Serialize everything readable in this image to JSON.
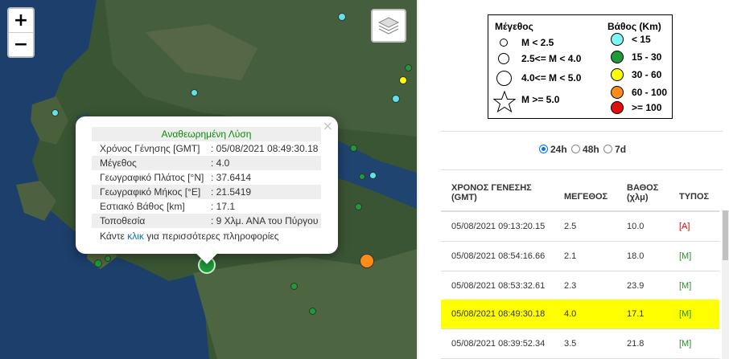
{
  "map": {
    "zoom_in_label": "+",
    "zoom_out_label": "−",
    "layers_icon": "layers-icon",
    "popup": {
      "title": "Αναθεωρημένη Λύση",
      "close_label": "×",
      "rows": [
        {
          "label": "Χρόνος Γένησης [GMT]",
          "value": ": 05/08/2021 08:49:30.18"
        },
        {
          "label": "Μέγεθος",
          "value": ": 4.0"
        },
        {
          "label": "Γεωγραφικό Πλάτος [°N]",
          "value": ": 37.6414"
        },
        {
          "label": "Γεωγραφικό Μήκος [°E]",
          "value": ": 21.5419"
        },
        {
          "label": "Εστιακό Βάθος [km]",
          "value": ": 17.1"
        },
        {
          "label": "Τοποθεσία",
          "value": ": 9 Χλμ. ΑΝΑ του Πύργου"
        }
      ],
      "footer_prefix": "Κάντε",
      "footer_link": "κλικ",
      "footer_suffix": "για περισσότερες πληροφορίες"
    }
  },
  "legend": {
    "magnitude_title": "Μέγεθος",
    "depth_title": "Βάθος (Km)",
    "magnitude_items": [
      "M < 2.5",
      "2.5<= M < 4.0",
      "4.0<= M < 5.0",
      "M >= 5.0"
    ],
    "depth_items": [
      {
        "label": "< 15",
        "color": "#7ff5f5"
      },
      {
        "label": "15 - 30",
        "color": "#1e9a3a"
      },
      {
        "label": "30 - 60",
        "color": "#ffff00"
      },
      {
        "label": "60 - 100",
        "color": "#ff8c1a"
      },
      {
        "label": ">= 100",
        "color": "#e01010"
      }
    ]
  },
  "filters": {
    "options": [
      "24h",
      "48h",
      "7d"
    ],
    "selected": "24h"
  },
  "table": {
    "headers": {
      "time": "ΧΡΟΝΟΣ ΓΕΝΕΣΗΣ (GMT)",
      "magnitude": "ΜΕΓΕΘΟΣ",
      "depth": "ΒΑΘΟΣ (χλμ)",
      "type": "ΤΥΠΟΣ"
    },
    "rows": [
      {
        "time": "05/08/2021 09:13:20.15",
        "magnitude": "2.5",
        "depth": "10.0",
        "type": "[A]",
        "highlighted": false
      },
      {
        "time": "05/08/2021 08:54:16.66",
        "magnitude": "2.1",
        "depth": "18.0",
        "type": "[M]",
        "highlighted": false
      },
      {
        "time": "05/08/2021 08:53:32.61",
        "magnitude": "2.3",
        "depth": "23.9",
        "type": "[M]",
        "highlighted": false
      },
      {
        "time": "05/08/2021 08:49:30.18",
        "magnitude": "4.0",
        "depth": "17.1",
        "type": "[M]",
        "highlighted": true
      },
      {
        "time": "05/08/2021 08:39:52.34",
        "magnitude": "3.5",
        "depth": "21.8",
        "type": "[M]",
        "highlighted": false
      }
    ]
  },
  "colors": {
    "highlight_row": "#ffff00",
    "popup_title": "#0a8a0a",
    "link": "#0078a8"
  }
}
